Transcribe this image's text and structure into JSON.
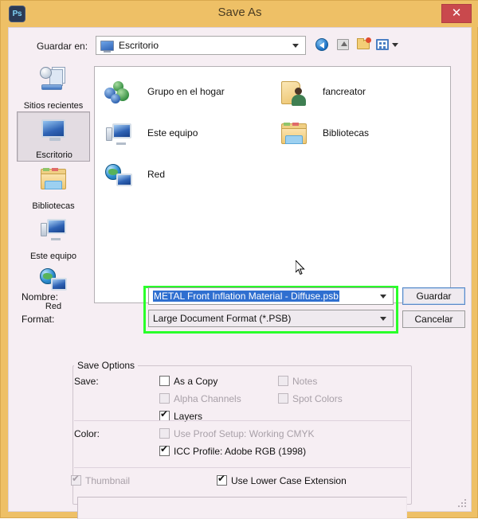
{
  "window": {
    "app_icon": "photoshop-ps-icon",
    "app_icon_label": "Ps",
    "title": "Save As",
    "close_label": "✕"
  },
  "lookin": {
    "label": "Guardar en:",
    "value": "Escritorio",
    "icon": "desktop-monitor-icon",
    "toolbar": [
      {
        "name": "back-icon",
        "title": "Atrás"
      },
      {
        "name": "up-folder-icon",
        "title": "Subir un nivel"
      },
      {
        "name": "new-folder-icon",
        "title": "Crear nueva carpeta"
      },
      {
        "name": "views-icon",
        "title": "Vistas"
      }
    ]
  },
  "places": [
    {
      "label": "Sitios recientes",
      "icon": "recent-places-icon",
      "selected": false
    },
    {
      "label": "Escritorio",
      "icon": "desktop-icon",
      "selected": true
    },
    {
      "label": "Bibliotecas",
      "icon": "libraries-icon",
      "selected": false
    },
    {
      "label": "Este equipo",
      "icon": "computer-icon",
      "selected": false
    },
    {
      "label": "Red",
      "icon": "network-icon",
      "selected": false
    }
  ],
  "files": [
    {
      "label": "Grupo en el hogar",
      "icon": "homegroup-icon",
      "col": 0,
      "row": 0
    },
    {
      "label": "Este equipo",
      "icon": "computer-icon",
      "col": 0,
      "row": 1
    },
    {
      "label": "Red",
      "icon": "network-icon",
      "col": 0,
      "row": 2
    },
    {
      "label": "fancreator",
      "icon": "user-folder-icon",
      "col": 1,
      "row": 0
    },
    {
      "label": "Bibliotecas",
      "icon": "libraries-folder-icon",
      "col": 1,
      "row": 1
    }
  ],
  "fields": {
    "name_label": "Nombre:",
    "name_value": "METAL Front Inflation Material - Diffuse.psb",
    "format_label": "Format:",
    "format_value": "Large Document Format (*.PSB)",
    "highlight_color": "#2aff2a"
  },
  "buttons": {
    "save": "Guardar",
    "cancel": "Cancelar"
  },
  "save_options": {
    "group_title": "Save Options",
    "save_label": "Save:",
    "color_label": "Color:",
    "save_items": [
      {
        "label": "As a Copy",
        "checked": false,
        "disabled": false,
        "col": 0,
        "row": 0
      },
      {
        "label": "Alpha Channels",
        "checked": false,
        "disabled": true,
        "col": 0,
        "row": 1
      },
      {
        "label": "Layers",
        "checked": true,
        "disabled": false,
        "col": 0,
        "row": 2
      },
      {
        "label": "Notes",
        "checked": false,
        "disabled": true,
        "col": 1,
        "row": 0
      },
      {
        "label": "Spot Colors",
        "checked": false,
        "disabled": true,
        "col": 1,
        "row": 1
      }
    ],
    "color_items": [
      {
        "label": "Use Proof Setup:  Working CMYK",
        "checked": false,
        "disabled": true,
        "row": 0
      },
      {
        "label": "ICC Profile:  Adobe RGB (1998)",
        "checked": true,
        "disabled": false,
        "row": 1
      }
    ],
    "footer_items": [
      {
        "label": "Thumbnail",
        "checked": true,
        "disabled": true,
        "col": 0
      },
      {
        "label": "Use Lower Case Extension",
        "checked": true,
        "disabled": false,
        "col": 1
      }
    ],
    "note_value": ""
  }
}
